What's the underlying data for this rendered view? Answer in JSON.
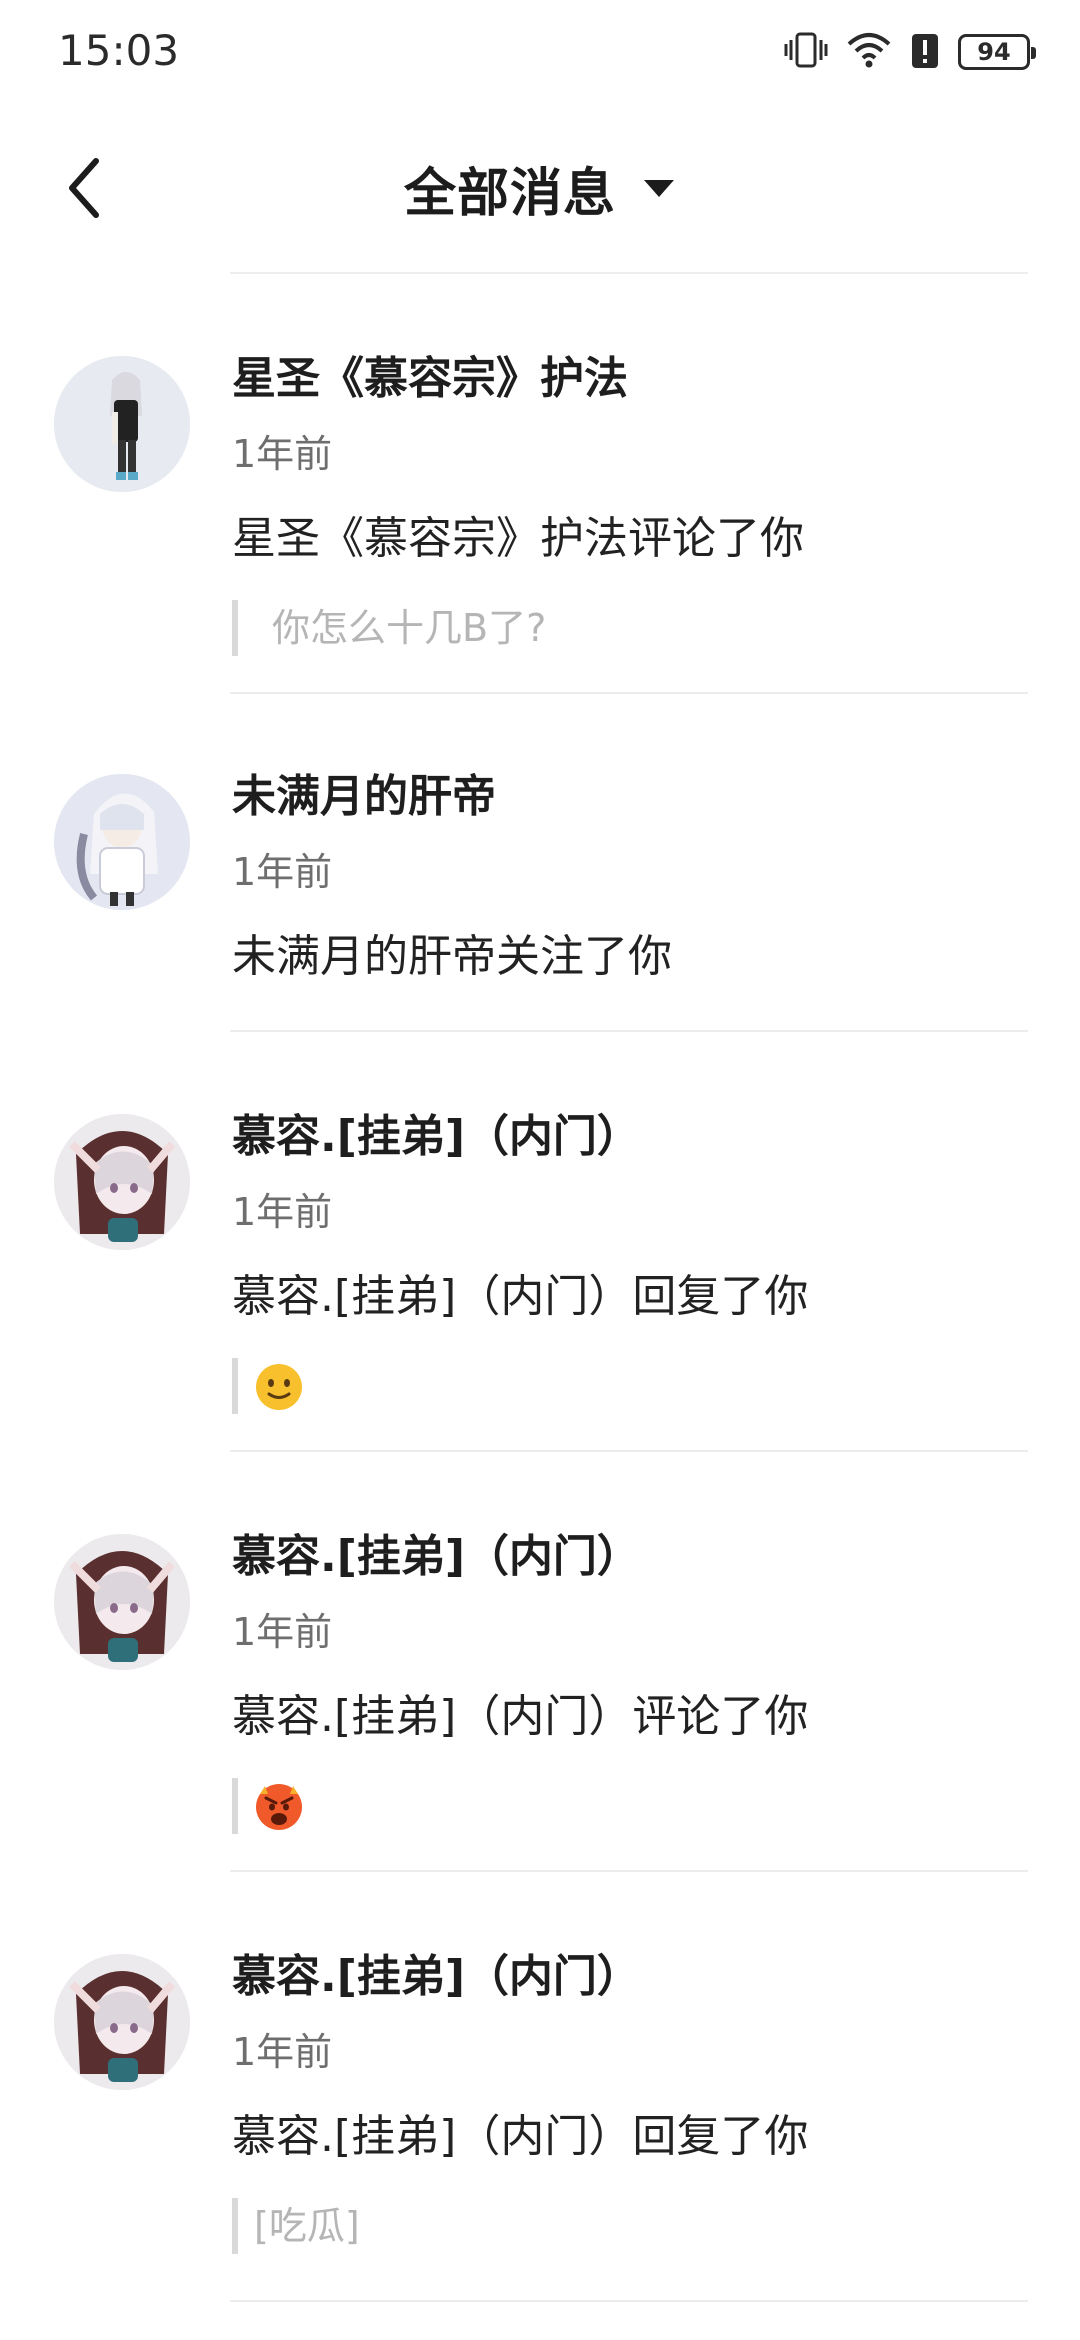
{
  "status_bar": {
    "time": "15:03",
    "battery": "94",
    "icons": [
      "vibrate-icon",
      "wifi-icon",
      "alert-icon",
      "battery-icon"
    ]
  },
  "header": {
    "title": "全部消息",
    "back_icon": "chevron-left-icon",
    "dropdown_icon": "caret-down-icon"
  },
  "messages": [
    {
      "name": "星圣《慕容宗》护法",
      "time": "1年前",
      "action": "星圣《慕容宗》护法评论了你",
      "quote": "你怎么十几B了?",
      "quote_type": "text"
    },
    {
      "name": "未满月的肝帝",
      "time": "1年前",
      "action": "未满月的肝帝关注了你",
      "quote": "",
      "quote_type": "none"
    },
    {
      "name": "慕容.[挂弟]（内门）",
      "time": "1年前",
      "action": "慕容.[挂弟]（内门）回复了你",
      "quote": "",
      "quote_type": "emoji",
      "emoji": "slight-smile-emoji"
    },
    {
      "name": "慕容.[挂弟]（内门）",
      "time": "1年前",
      "action": "慕容.[挂弟]（内门）评论了你",
      "quote": "",
      "quote_type": "emoji",
      "emoji": "angry-face-emoji"
    },
    {
      "name": "慕容.[挂弟]（内门）",
      "time": "1年前",
      "action": "慕容.[挂弟]（内门）回复了你",
      "quote": "[吃瓜]",
      "quote_type": "text"
    }
  ]
}
